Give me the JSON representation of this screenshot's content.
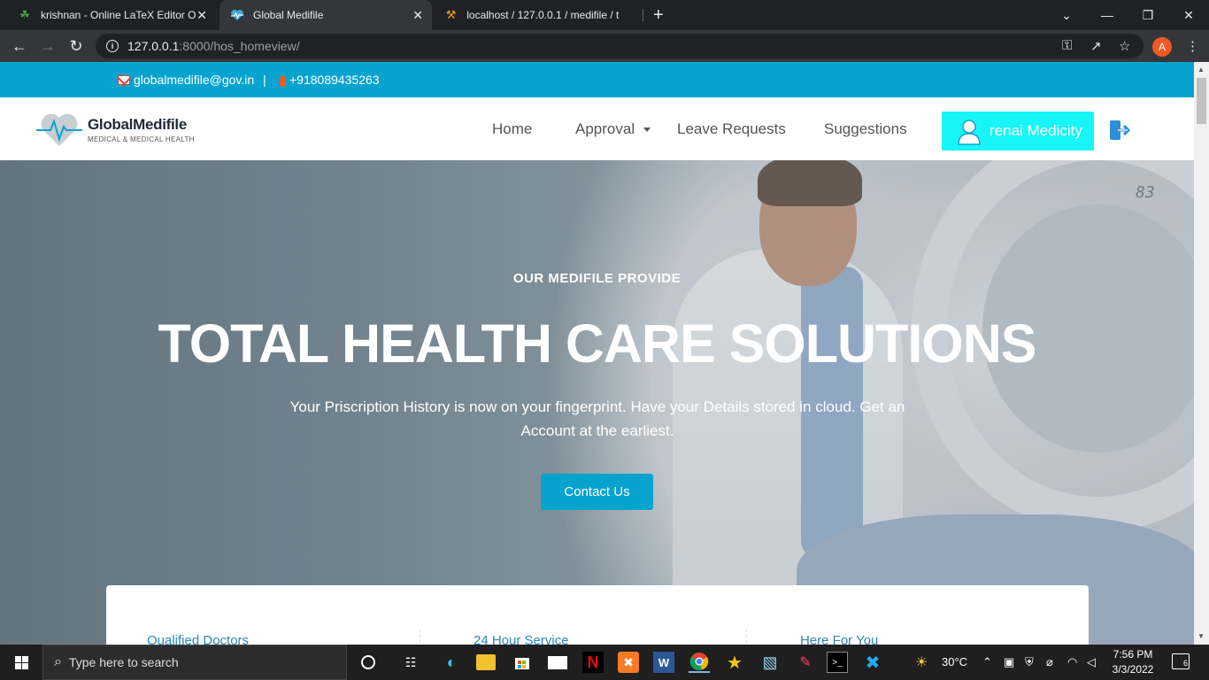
{
  "browser": {
    "tabs": [
      {
        "title": "krishnan - Online LaTeX Editor O",
        "active": false
      },
      {
        "title": "Global Medifile",
        "active": true
      },
      {
        "title": "localhost / 127.0.0.1 / medifile / t",
        "active": false
      }
    ],
    "url_host": "127.0.0.1",
    "url_path": ":8000/hos_homeview/",
    "profile_initial": "A"
  },
  "site": {
    "email": "globalmedifile@gov.in",
    "separator": "|",
    "phone": "+918089435263",
    "logo_name": "GlobalMedifile",
    "logo_tagline": "MEDICAL & MEDICAL HEALTH",
    "nav": {
      "home": "Home",
      "approval": "Approval",
      "leave_requests": "Leave Requests",
      "suggestions": "Suggestions"
    },
    "user_name": "renai Medicity",
    "hero": {
      "kicker": "OUR MEDIFILE PROVIDE",
      "headline": "TOTAL HEALTH CARE SOLUTIONS",
      "description": "Your Priscription History is now on your fingerprint. Have your Details stored in cloud. Get an Account at the earliest.",
      "cta": "Contact Us",
      "machine_display": "83"
    },
    "features": [
      "Qualified Doctors",
      "24 Hour Service",
      "Here For You"
    ],
    "colors": {
      "accent": "#06a3cf",
      "user_button": "#17f5f8"
    }
  },
  "taskbar": {
    "search_placeholder": "Type here to search",
    "weather": "30°C",
    "time": "7:56 PM",
    "date": "3/3/2022",
    "notification_count": "6"
  }
}
